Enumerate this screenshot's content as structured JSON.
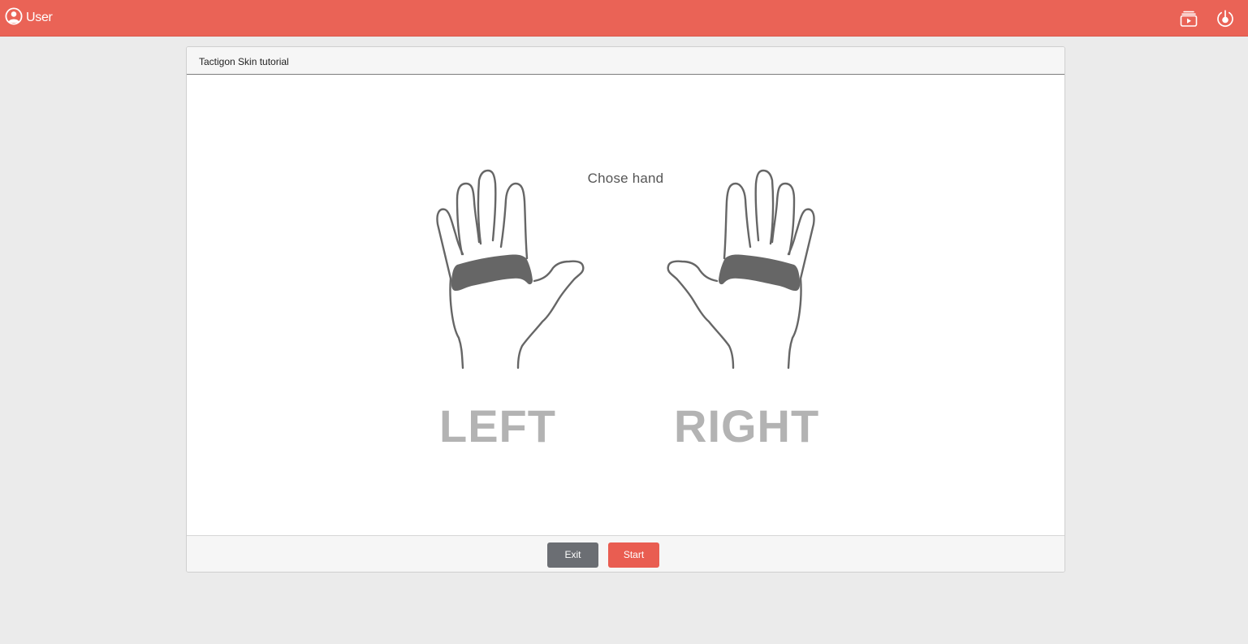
{
  "topbar": {
    "user_label": "User",
    "user_icon": "user-circle-icon",
    "video_icon": "video-tutorial-icon",
    "power_icon": "power-icon",
    "accent_color": "#ea6356"
  },
  "panel": {
    "title": "Tactigon Skin tutorial",
    "instruction": "Chose hand",
    "hands": [
      {
        "label": "LEFT",
        "icon": "left-hand-icon"
      },
      {
        "label": "RIGHT",
        "icon": "right-hand-icon"
      }
    ],
    "buttons": {
      "exit_label": "Exit",
      "start_label": "Start",
      "exit_color": "#6b6e73",
      "start_color": "#e95d51"
    }
  }
}
